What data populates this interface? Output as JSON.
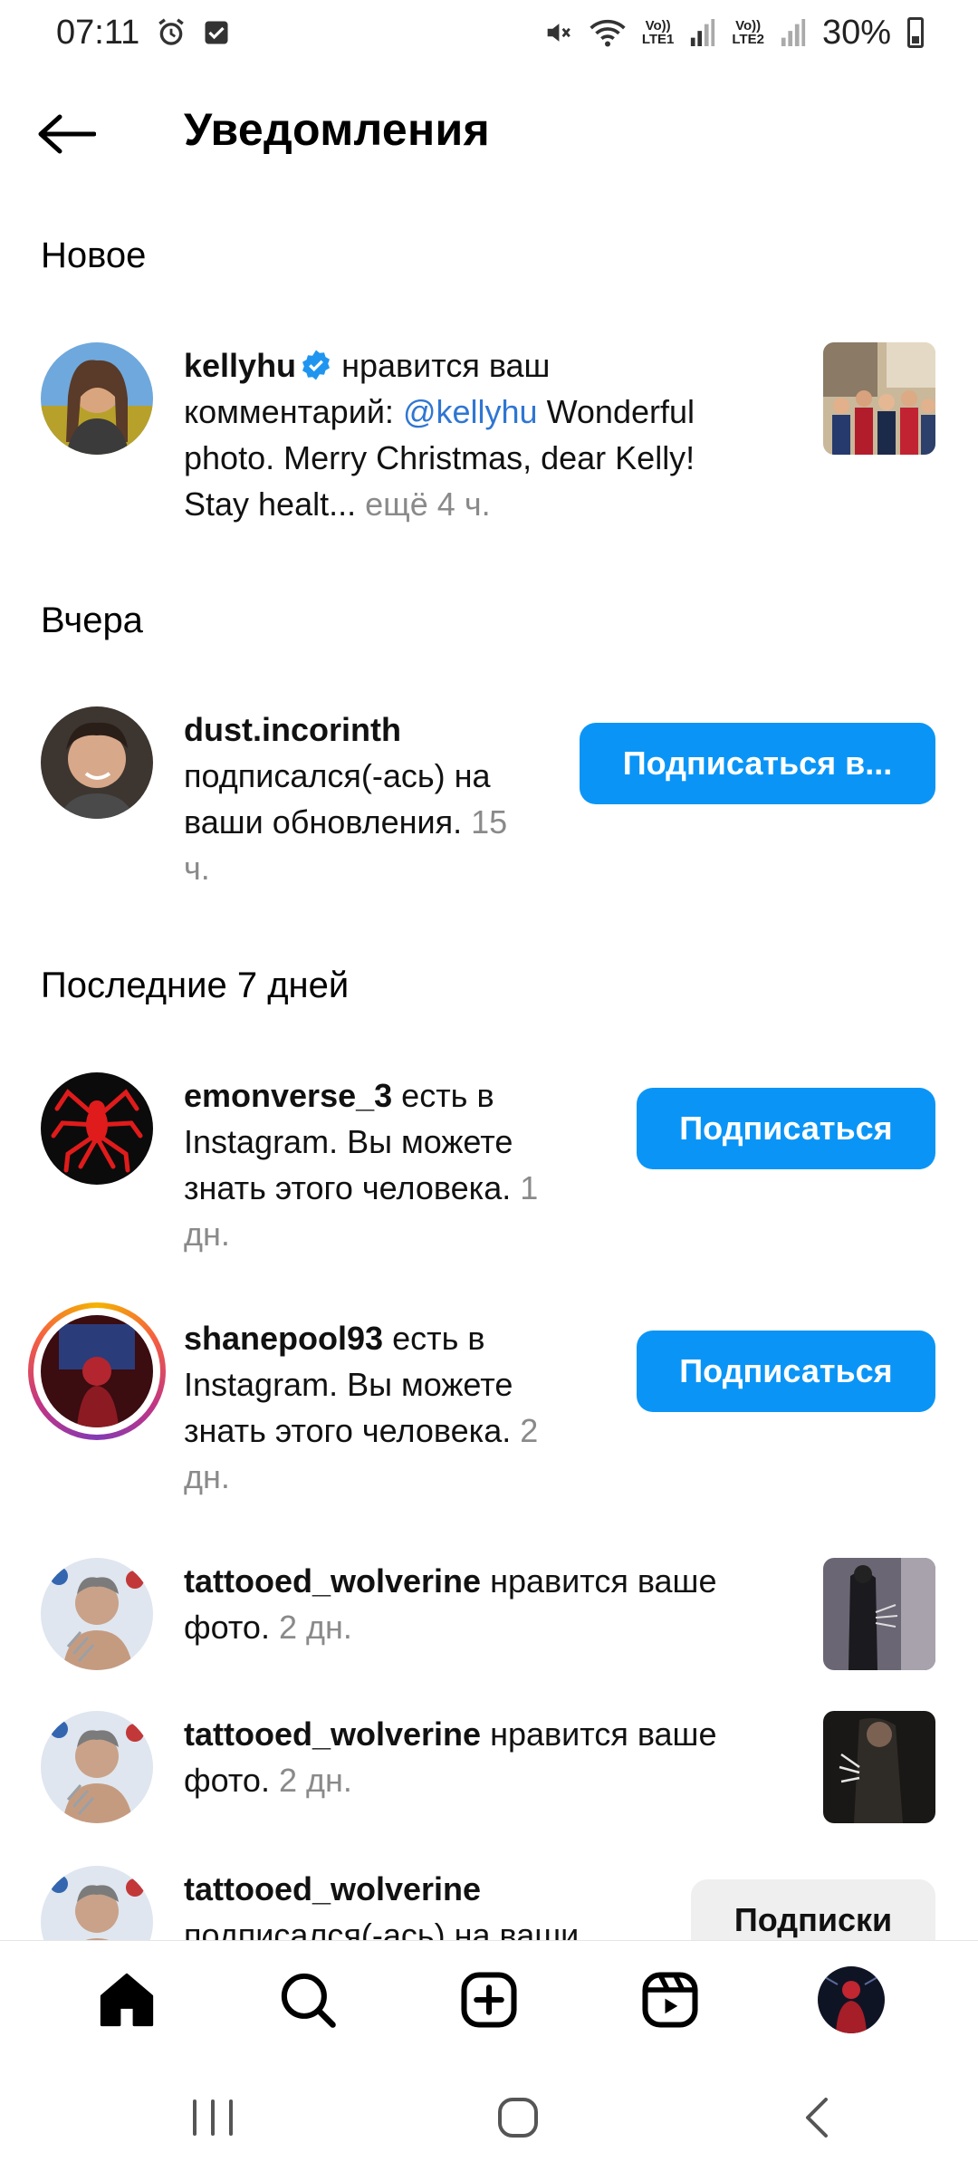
{
  "status_bar": {
    "time": "07:11",
    "lte1_top": "Vo))",
    "lte1_bottom": "LTE1",
    "lte2_top": "Vo))",
    "lte2_bottom": "LTE2",
    "battery_percent": "30%"
  },
  "header": {
    "title": "Уведомления"
  },
  "sections": {
    "new": "Новое",
    "yesterday": "Вчера",
    "last7": "Последние 7 дней"
  },
  "notifications": [
    {
      "username": "kellyhu",
      "line1_rest": "нравится ваш",
      "line2_prefix": "комментарий:",
      "mention": "@kellyhu",
      "line2_rest": "Wonderful",
      "line3": "photo. Merry Christmas, dear Kelly!",
      "line4": "Stay healt...",
      "more": "ещё 4 ч."
    },
    {
      "username": "dust.incorinth",
      "line2": "подписался(-ась) на",
      "line3": "ваши обновления.",
      "time_a": "15",
      "time_b": "ч.",
      "button": "Подписаться в..."
    },
    {
      "username": "emonverse_3",
      "line1_rest": "есть в",
      "line2": "Instagram. Вы можете",
      "line3": "знать этого человека.",
      "time_a": "1",
      "time_b": "дн.",
      "button": "Подписаться"
    },
    {
      "username": "shanepool93",
      "line1_rest": "есть в",
      "line2": "Instagram. Вы можете",
      "line3": "знать этого человека.",
      "time_a": "2",
      "time_b": "дн.",
      "button": "Подписаться"
    },
    {
      "username": "tattooed_wolverine",
      "line1_rest": "нравится ваше",
      "line2": "фото.",
      "time": "2 дн."
    },
    {
      "username": "tattooed_wolverine",
      "line1_rest": "нравится ваше",
      "line2": "фото.",
      "time": "2 дн."
    },
    {
      "username": "tattooed_wolverine",
      "line2": "подписался(-ась) на ваши",
      "button": "Подписки"
    }
  ],
  "colors": {
    "accent": "#0a95f6",
    "link": "#2f76d2",
    "muted": "#8a8a8a"
  }
}
